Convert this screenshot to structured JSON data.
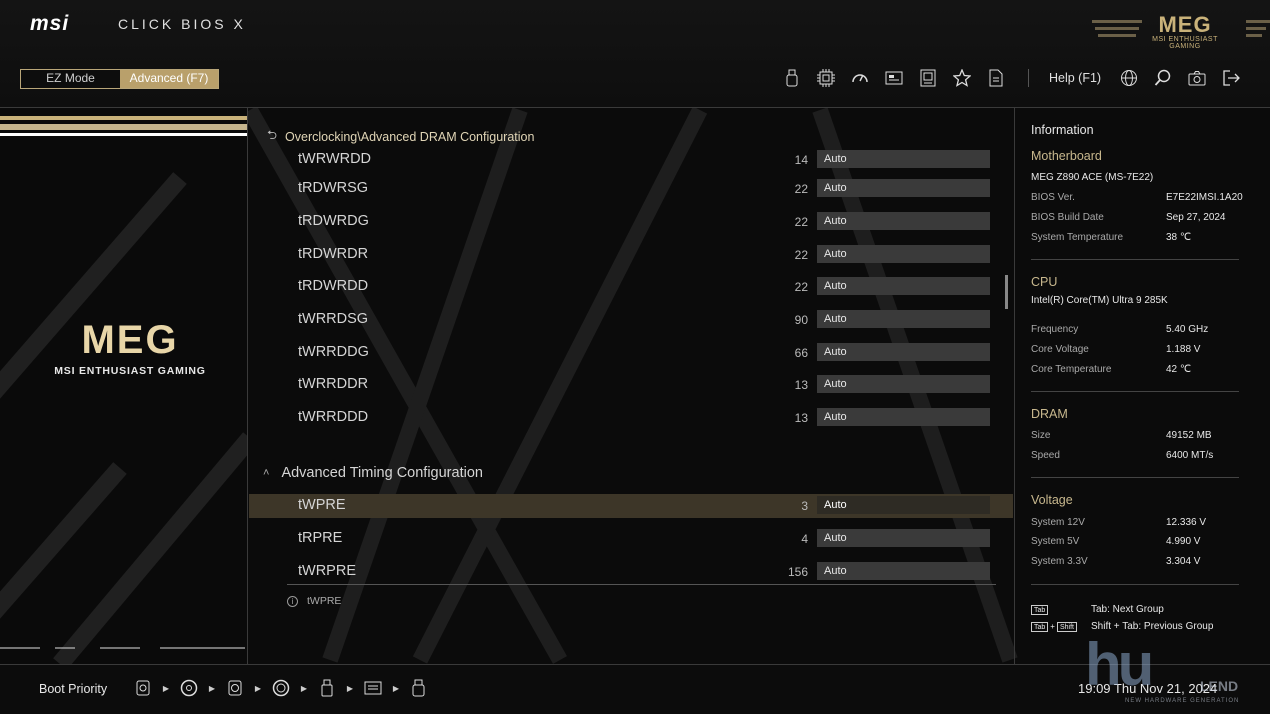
{
  "header": {
    "brand": "msi",
    "product": "CLICK BIOS X",
    "logo_text": "MEG",
    "logo_tagline": "MSI ENTHUSIAST GAMING",
    "modes": [
      {
        "label": "EZ Mode",
        "active": false
      },
      {
        "label": "Advanced (F7)",
        "active": true
      }
    ],
    "toolbar_icons": [
      "usb-icon",
      "cpu-icon",
      "gauge-icon",
      "monitor-icon",
      "memory-icon",
      "star-icon",
      "document-icon"
    ],
    "help_label": "Help (F1)",
    "right_icons": [
      "globe-icon",
      "search-icon",
      "camera-icon",
      "exit-icon"
    ]
  },
  "left_panel": {
    "logo_text": "MEG",
    "tagline": "MSI ENTHUSIAST GAMING"
  },
  "main": {
    "breadcrumb": "Overclocking\\Advanced DRAM Configuration",
    "rows": [
      {
        "name": "tWRWRDD",
        "num": "14",
        "value": "Auto"
      },
      {
        "name": "tRDWRSG",
        "num": "22",
        "value": "Auto"
      },
      {
        "name": "tRDWRDG",
        "num": "22",
        "value": "Auto"
      },
      {
        "name": "tRDWRDR",
        "num": "22",
        "value": "Auto"
      },
      {
        "name": "tRDWRDD",
        "num": "22",
        "value": "Auto"
      },
      {
        "name": "tWRRDSG",
        "num": "90",
        "value": "Auto"
      },
      {
        "name": "tWRRDDG",
        "num": "66",
        "value": "Auto"
      },
      {
        "name": "tWRRDDR",
        "num": "13",
        "value": "Auto"
      },
      {
        "name": "tWRRDDD",
        "num": "13",
        "value": "Auto"
      }
    ],
    "group_header": "Advanced Timing Configuration",
    "group_rows": [
      {
        "name": "tWPRE",
        "num": "3",
        "value": "Auto",
        "selected": true
      },
      {
        "name": "tRPRE",
        "num": "4",
        "value": "Auto",
        "selected": false
      },
      {
        "name": "tWRPRE",
        "num": "156",
        "value": "Auto",
        "selected": false
      }
    ],
    "hint": "tWPRE"
  },
  "info": {
    "title": "Information",
    "motherboard": {
      "heading": "Motherboard",
      "model": "MEG Z890 ACE (MS-7E22)",
      "items": [
        {
          "k": "BIOS Ver.",
          "v": "E7E22IMSI.1A20"
        },
        {
          "k": "BIOS Build Date",
          "v": "Sep 27, 2024"
        },
        {
          "k": "System Temperature",
          "v": "38 ℃"
        }
      ]
    },
    "cpu": {
      "heading": "CPU",
      "model": "Intel(R) Core(TM) Ultra 9 285K",
      "items": [
        {
          "k": "Frequency",
          "v": "5.40 GHz"
        },
        {
          "k": "Core Voltage",
          "v": "1.188 V"
        },
        {
          "k": "Core Temperature",
          "v": "42 ℃"
        }
      ]
    },
    "dram": {
      "heading": "DRAM",
      "items": [
        {
          "k": "Size",
          "v": "49152 MB"
        },
        {
          "k": "Speed",
          "v": "6400 MT/s"
        }
      ]
    },
    "voltage": {
      "heading": "Voltage",
      "items": [
        {
          "k": "System 12V",
          "v": "12.336 V"
        },
        {
          "k": "System 5V",
          "v": "4.990 V"
        },
        {
          "k": "System 3.3V",
          "v": "3.304 V"
        }
      ]
    },
    "keys": [
      {
        "caps": [
          "Tab"
        ],
        "text": "Tab: Next Group"
      },
      {
        "caps": [
          "Tab",
          "Shift"
        ],
        "text": "Shift + Tab: Previous Group"
      }
    ]
  },
  "footer": {
    "boot_label": "Boot Priority",
    "boot_devices": [
      "usb-hdd-icon",
      "cd-icon",
      "usb-cd-icon",
      "disk-icon",
      "usb-key-icon",
      "network-icon",
      "usb-floppy-icon"
    ],
    "clock": "19:09  Thu Nov 21, 2024"
  },
  "watermark": {
    "big": "hu",
    "word": "LEND",
    "sub": "NEW HARDWARE GENERATION"
  },
  "colors": {
    "accent": "#b9a06b",
    "selected_row": "#3d3628",
    "field": "#3a3a3a"
  }
}
